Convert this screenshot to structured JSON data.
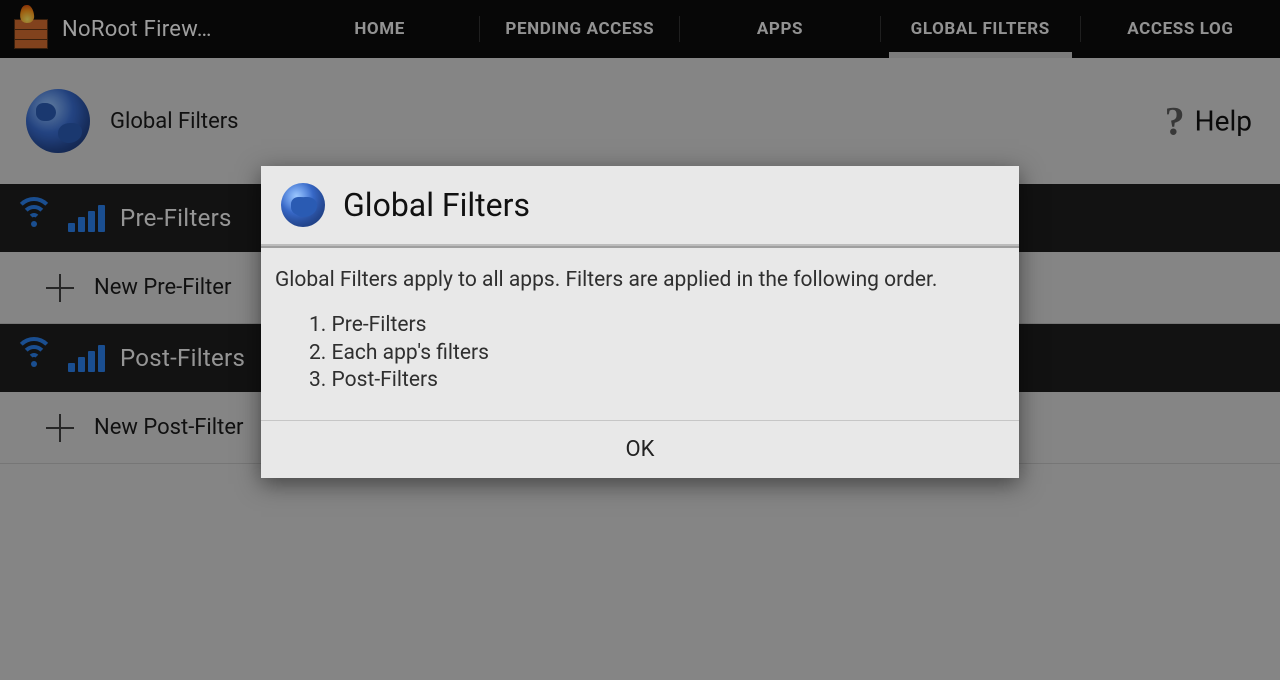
{
  "app_title": "NoRoot Firew…",
  "tabs": {
    "home": "HOME",
    "pending": "PENDING ACCESS",
    "apps": "APPS",
    "global": "GLOBAL FILTERS",
    "log": "ACCESS LOG",
    "active": "global"
  },
  "page": {
    "title": "Global Filters",
    "help_label": "Help"
  },
  "sections": {
    "pre": {
      "label": "Pre-Filters",
      "new_label": "New Pre-Filter"
    },
    "post": {
      "label": "Post-Filters",
      "new_label": "New Post-Filter"
    }
  },
  "dialog": {
    "title": "Global Filters",
    "intro": "Global Filters apply to all apps. Filters are applied in the following order.",
    "order": [
      "1. Pre-Filters",
      "2. Each app's filters",
      "3. Post-Filters"
    ],
    "ok": "OK"
  }
}
